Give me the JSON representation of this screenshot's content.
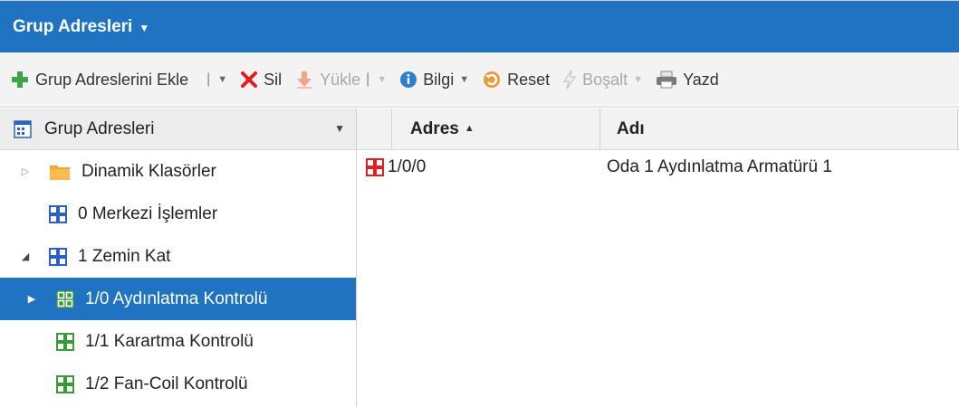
{
  "title": {
    "text": "Grup Adresleri",
    "caret": "▼"
  },
  "toolbar": {
    "add_label": "Grup Adreslerini Ekle",
    "delete_label": "Sil",
    "load_label": "Yükle",
    "info_label": "Bilgi",
    "reset_label": "Reset",
    "empty_label": "Boşalt",
    "print_label": "Yazd",
    "sep": "|",
    "dd": "▼"
  },
  "left_header": {
    "label": "Grup Adresleri",
    "dd": "▼"
  },
  "tree": {
    "items": [
      {
        "label": "Dinamik Klasörler",
        "arrow": "▷"
      },
      {
        "label": "0 Merkezi İşlemler",
        "arrow": ""
      },
      {
        "label": "1 Zemin Kat",
        "arrow": "◢"
      },
      {
        "label": "1/0 Aydınlatma Kontrolü",
        "arrow": "▶"
      },
      {
        "label": "1/1 Karartma Kontrolü",
        "arrow": ""
      },
      {
        "label": "1/2 Fan-Coil Kontrolü",
        "arrow": ""
      }
    ]
  },
  "grid": {
    "col_adres": "Adres",
    "sort": "▲",
    "col_adi": "Adı",
    "rows": [
      {
        "adres": "1/0/0",
        "adi": "Oda 1 Aydınlatma Armatürü 1"
      }
    ]
  },
  "colors": {
    "accent": "#1f73c0",
    "green": "#3aa64a",
    "red": "#e02020",
    "group_blue": "#2b62c0",
    "group_green": "#3a9a3a"
  }
}
